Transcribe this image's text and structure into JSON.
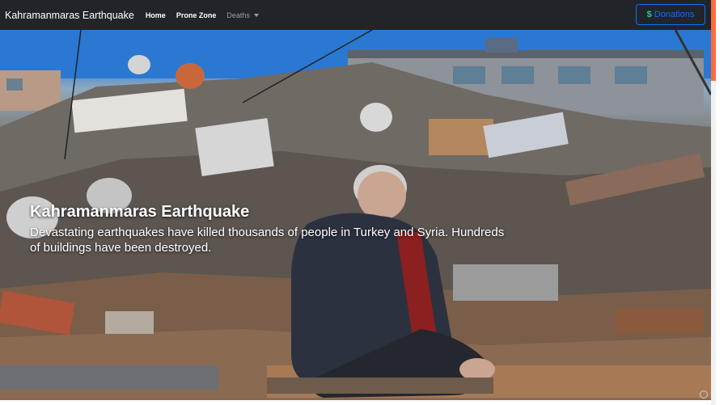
{
  "navbar": {
    "brand": "Kahramanmaras Earthquake",
    "links": [
      {
        "label": "Home"
      },
      {
        "label": "Prone Zone"
      },
      {
        "label": "Deaths"
      }
    ],
    "donate": {
      "icon": "dollar-icon",
      "symbol": "$",
      "label": "Donations"
    }
  },
  "hero": {
    "title": "Kahramanmaras Earthquake",
    "text": "Devastating earthquakes have killed thousands of people in Turkey and Syria. Hundreds of buildings have been destroyed."
  },
  "colors": {
    "navbar_bg": "#212529",
    "donate_accent": "#0d6efd",
    "dollar_icon": "#20c997",
    "scroll_thumb": "#ff6a3d"
  }
}
